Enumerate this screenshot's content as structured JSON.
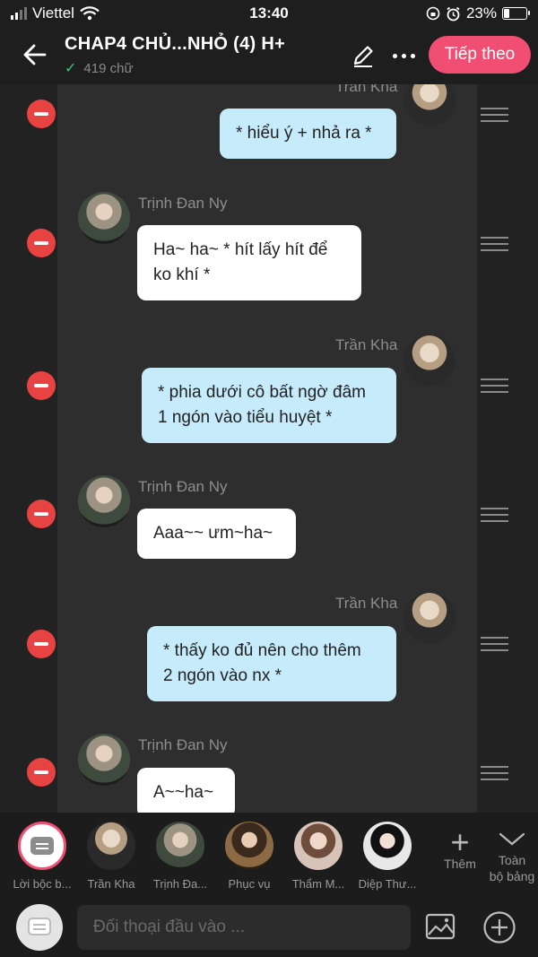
{
  "status": {
    "carrier": "Viettel",
    "time": "13:40",
    "battery": "23%"
  },
  "header": {
    "title": "CHAP4 CHỦ...NHỎ (4) H+",
    "word_count": "419 chữ",
    "next_label": "Tiếp theo"
  },
  "messages": [
    {
      "side": "me",
      "name": "Trần Kha",
      "text_lines": [
        "* hiểu ý + nhả ra *"
      ]
    },
    {
      "side": "other",
      "name": "Trịnh Đan Ny",
      "text_lines": [
        "Ha~ ha~ * hít lấy hít để",
        "ko khí *"
      ]
    },
    {
      "side": "me",
      "name": "Trần Kha",
      "text_lines": [
        "* phia dưới cô bất ngờ đâm",
        "1 ngón vào tiểu huyệt *"
      ]
    },
    {
      "side": "other",
      "name": "Trịnh Đan Ny",
      "text_lines": [
        "Aaa~~ ưm~ha~"
      ]
    },
    {
      "side": "me",
      "name": "Trần Kha",
      "text_lines": [
        "* thấy ko đủ nên cho thêm",
        "2 ngón vào nx *"
      ]
    },
    {
      "side": "other",
      "name": "Trịnh Đan Ny",
      "text_lines": [
        "A~~ha~"
      ]
    }
  ],
  "characters": [
    {
      "label": "Lời bộc b..."
    },
    {
      "label": "Trần Kha"
    },
    {
      "label": "Trịnh Đa..."
    },
    {
      "label": "Phục vụ"
    },
    {
      "label": "Thẩm M..."
    },
    {
      "label": "Diệp Thư..."
    }
  ],
  "toolbar": {
    "add_label": "Thêm",
    "all_label_1": "Toàn",
    "all_label_2": "bộ bảng"
  },
  "input": {
    "placeholder": "Đối thoại đầu vào ..."
  }
}
